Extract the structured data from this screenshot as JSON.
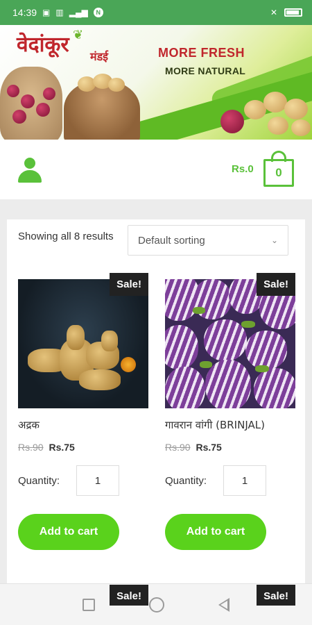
{
  "status_bar": {
    "time": "14:39"
  },
  "banner": {
    "brand": "वेदांकूर",
    "brand_sub": "मंडई",
    "tagline_1": "MORE FRESH",
    "tagline_2": "MORE NATURAL"
  },
  "header": {
    "cart_total": "Rs.0",
    "cart_count": "0"
  },
  "shop": {
    "results_text": "Showing all 8 results",
    "sort_selected": "Default sorting",
    "quantity_label": "Quantity:",
    "products": [
      {
        "name": "अद्रक",
        "old_price": "Rs.90",
        "price": "Rs.75",
        "sale": "Sale!",
        "quantity": "1",
        "add_to_cart": "Add to cart"
      },
      {
        "name": "गावरान वांगी (BRINJAL)",
        "old_price": "Rs.90",
        "price": "Rs.75",
        "sale": "Sale!",
        "quantity": "1",
        "add_to_cart": "Add to cart"
      }
    ],
    "next_row_sale_labels": [
      "Sale!",
      "Sale!"
    ]
  },
  "colors": {
    "accent_green": "#5ad21c",
    "status_green": "#4aa657",
    "brand_red": "#c0262c"
  }
}
